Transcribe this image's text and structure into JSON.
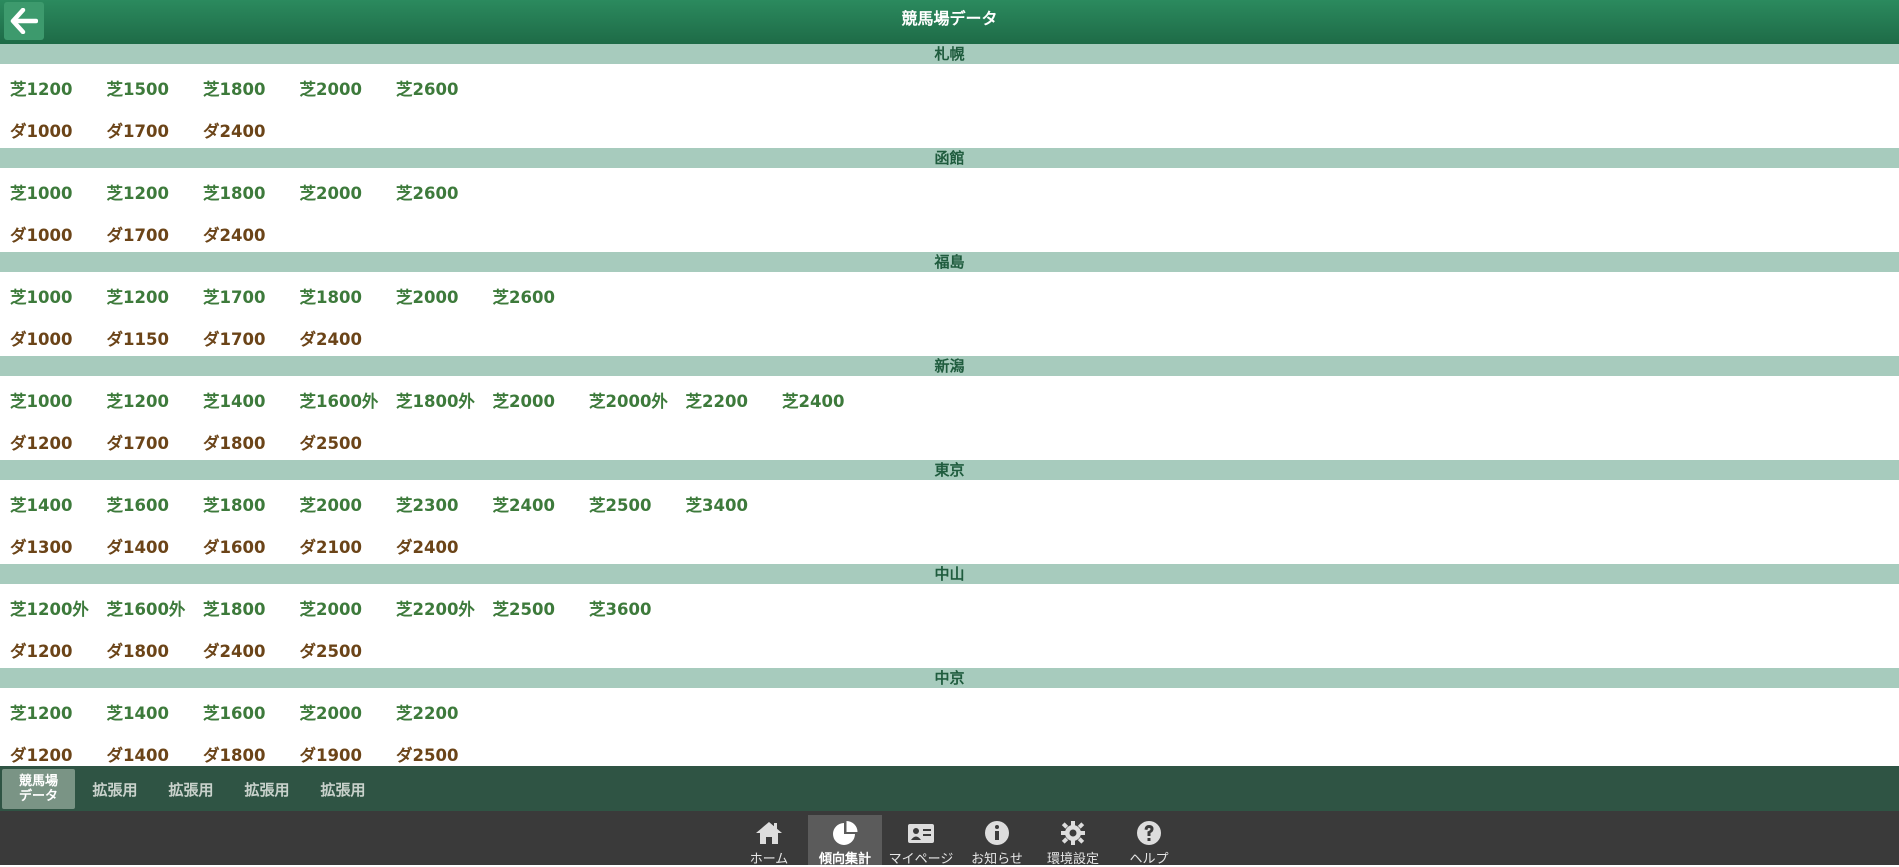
{
  "header": {
    "title": "競馬場データ",
    "back_icon": "arrow-left-icon"
  },
  "tracks": [
    {
      "name": "札幌",
      "turf": [
        "芝1200",
        "芝1500",
        "芝1800",
        "芝2000",
        "芝2600"
      ],
      "dirt": [
        "ダ1000",
        "ダ1700",
        "ダ2400"
      ]
    },
    {
      "name": "函館",
      "turf": [
        "芝1000",
        "芝1200",
        "芝1800",
        "芝2000",
        "芝2600"
      ],
      "dirt": [
        "ダ1000",
        "ダ1700",
        "ダ2400"
      ]
    },
    {
      "name": "福島",
      "turf": [
        "芝1000",
        "芝1200",
        "芝1700",
        "芝1800",
        "芝2000",
        "芝2600"
      ],
      "dirt": [
        "ダ1000",
        "ダ1150",
        "ダ1700",
        "ダ2400"
      ]
    },
    {
      "name": "新潟",
      "turf": [
        "芝1000",
        "芝1200",
        "芝1400",
        "芝1600外",
        "芝1800外",
        "芝2000",
        "芝2000外",
        "芝2200",
        "芝2400"
      ],
      "dirt": [
        "ダ1200",
        "ダ1700",
        "ダ1800",
        "ダ2500"
      ]
    },
    {
      "name": "東京",
      "turf": [
        "芝1400",
        "芝1600",
        "芝1800",
        "芝2000",
        "芝2300",
        "芝2400",
        "芝2500",
        "芝3400"
      ],
      "dirt": [
        "ダ1300",
        "ダ1400",
        "ダ1600",
        "ダ2100",
        "ダ2400"
      ]
    },
    {
      "name": "中山",
      "turf": [
        "芝1200外",
        "芝1600外",
        "芝1800",
        "芝2000",
        "芝2200外",
        "芝2500",
        "芝3600"
      ],
      "dirt": [
        "ダ1200",
        "ダ1800",
        "ダ2400",
        "ダ2500"
      ]
    },
    {
      "name": "中京",
      "turf": [
        "芝1200",
        "芝1400",
        "芝1600",
        "芝2000",
        "芝2200"
      ],
      "dirt": [
        "ダ1200",
        "ダ1400",
        "ダ1800",
        "ダ1900",
        "ダ2500"
      ]
    }
  ],
  "subtabs": [
    "競馬場\nデータ",
    "拡張用",
    "拡張用",
    "拡張用",
    "拡張用"
  ],
  "bottom_nav": [
    {
      "label": "ホーム",
      "icon": "home-icon"
    },
    {
      "label": "傾向集計",
      "icon": "pie-chart-icon",
      "active": true
    },
    {
      "label": "マイページ",
      "icon": "id-card-icon"
    },
    {
      "label": "お知らせ",
      "icon": "info-icon"
    },
    {
      "label": "環境設定",
      "icon": "gear-icon"
    },
    {
      "label": "ヘルプ",
      "icon": "help-icon"
    }
  ],
  "colors": {
    "header": "#1e6b47",
    "section": "#a7cbbd",
    "turf": "#3d7a3b",
    "dirt": "#6b4418",
    "subtabs": "#2f5444",
    "nav": "#3a3a3a"
  }
}
